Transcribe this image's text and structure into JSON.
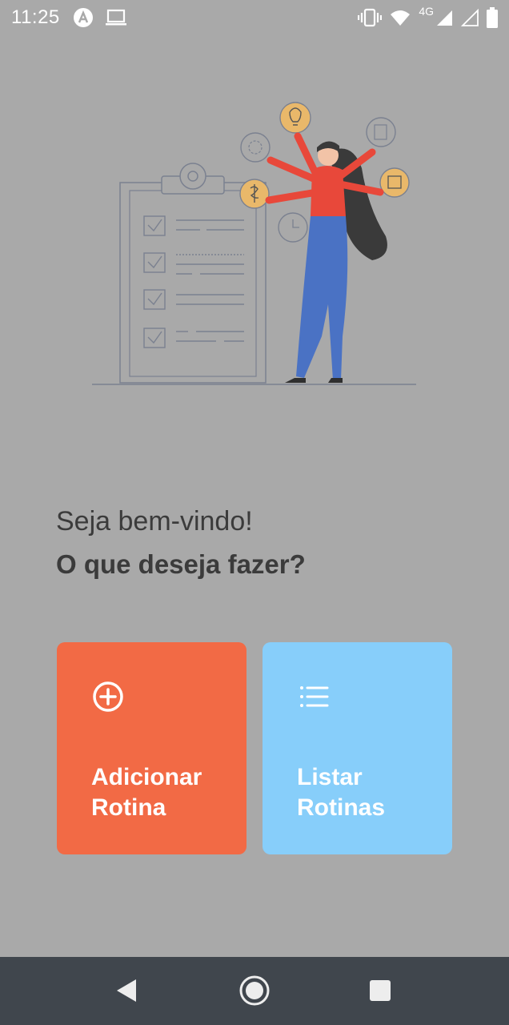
{
  "status_bar": {
    "time": "11:25",
    "network_label": "4G",
    "icons": [
      "app-a-icon",
      "laptop-icon",
      "vibrate-icon",
      "wifi-icon",
      "signal-icon",
      "signal-empty-icon",
      "battery-icon"
    ]
  },
  "main": {
    "greeting": "Seja bem-vindo!",
    "question": "O que deseja fazer?"
  },
  "cards": {
    "add": {
      "line1": "Adicionar",
      "line2": "Rotina",
      "icon": "plus-circle-icon",
      "color": "#F26A45"
    },
    "list": {
      "line1": "Listar",
      "line2": "Rotinas",
      "icon": "list-icon",
      "color": "#87CEFA"
    }
  },
  "nav_bar": {
    "icons": [
      "back-icon",
      "home-icon",
      "recents-icon"
    ],
    "color": "#40464D"
  },
  "colors": {
    "background": "#A9A9A9",
    "text": "#3B3B3B"
  }
}
